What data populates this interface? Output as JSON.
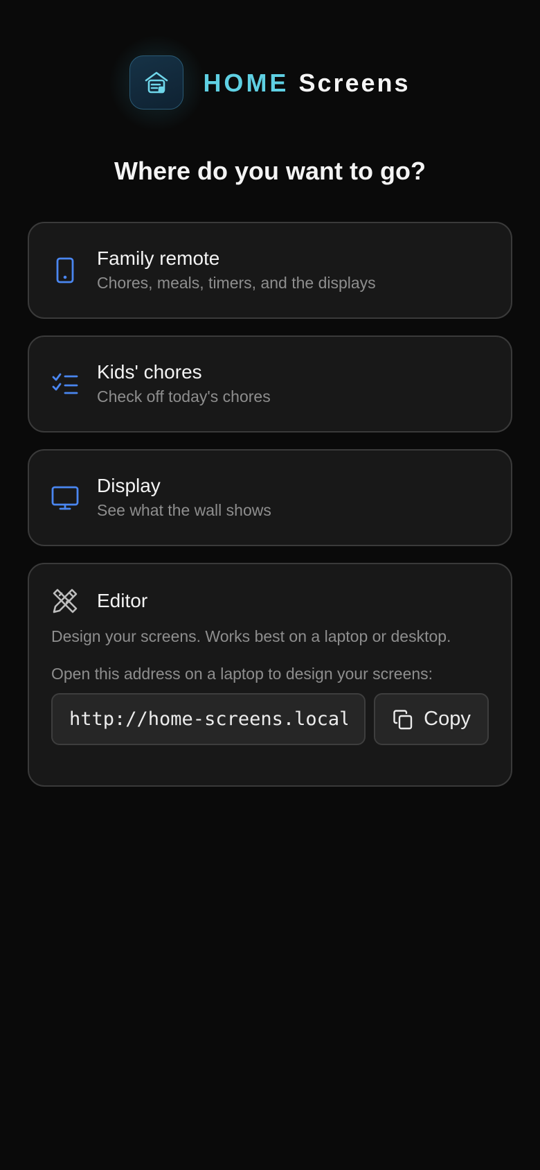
{
  "brand": {
    "home": "HOME",
    "screens": "Screens",
    "logo_icon": "house-screen-icon",
    "accent_color": "#5fd0e3"
  },
  "heading": "Where do you want to go?",
  "destinations": [
    {
      "title": "Family remote",
      "subtitle": "Chores, meals, timers, and the displays",
      "icon": "phone-icon"
    },
    {
      "title": "Kids' chores",
      "subtitle": "Check off today's chores",
      "icon": "checklist-icon"
    },
    {
      "title": "Display",
      "subtitle": "See what the wall shows",
      "icon": "monitor-icon"
    }
  ],
  "editor": {
    "title": "Editor",
    "icon": "pencil-ruler-icon",
    "description": "Design your screens. Works best on a laptop or desktop.",
    "hint": "Open this address on a laptop to design your screens:",
    "url_value": "http://home-screens.local",
    "copy_label": "Copy",
    "copy_icon": "copy-icon"
  },
  "colors": {
    "background": "#0a0a0a",
    "card": "#181818",
    "icon_blue": "#4a86f0"
  }
}
